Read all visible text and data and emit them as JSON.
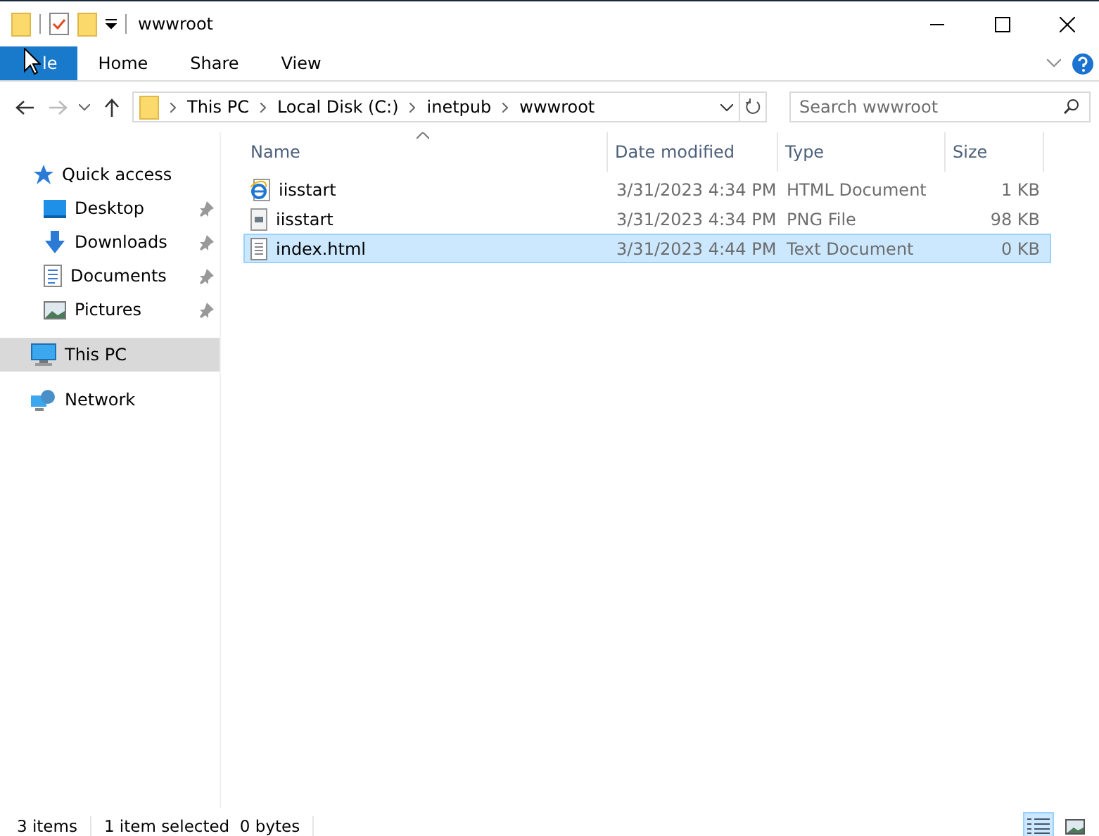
{
  "window": {
    "title": "wwwroot"
  },
  "ribbon_tabs": [
    {
      "label": "le",
      "selected": true
    },
    {
      "label": "Home",
      "selected": false
    },
    {
      "label": "Share",
      "selected": false
    },
    {
      "label": "View",
      "selected": false
    }
  ],
  "address": {
    "crumbs": [
      "This PC",
      "Local Disk (C:)",
      "inetpub",
      "wwwroot"
    ]
  },
  "search": {
    "placeholder": "Search wwwroot"
  },
  "sidebar": {
    "items": [
      {
        "label": "Quick access",
        "selected": false,
        "children": [
          {
            "label": "Desktop",
            "pinned": true,
            "selected": false
          },
          {
            "label": "Downloads",
            "pinned": true,
            "selected": false
          },
          {
            "label": "Documents",
            "pinned": true,
            "selected": false
          },
          {
            "label": "Pictures",
            "pinned": true,
            "selected": false
          }
        ]
      },
      {
        "label": "This PC",
        "selected": true
      },
      {
        "label": "Network",
        "selected": false
      }
    ]
  },
  "table": {
    "columns": [
      "Name",
      "Date modified",
      "Type",
      "Size"
    ],
    "rows": [
      {
        "name": "iisstart",
        "date": "3/31/2023 4:34 PM",
        "type": "HTML Document",
        "size": "1 KB",
        "selected": false
      },
      {
        "name": "iisstart",
        "date": "3/31/2023 4:34 PM",
        "type": "PNG File",
        "size": "98 KB",
        "selected": false
      },
      {
        "name": "index.html",
        "date": "3/31/2023 4:44 PM",
        "type": "Text Document",
        "size": "0 KB",
        "selected": true
      }
    ]
  },
  "status_bar": {
    "items": [
      "3 items",
      "1 item selected  0 bytes"
    ],
    "view_buttons": [
      {
        "selected": true
      },
      {
        "selected": false
      }
    ]
  }
}
